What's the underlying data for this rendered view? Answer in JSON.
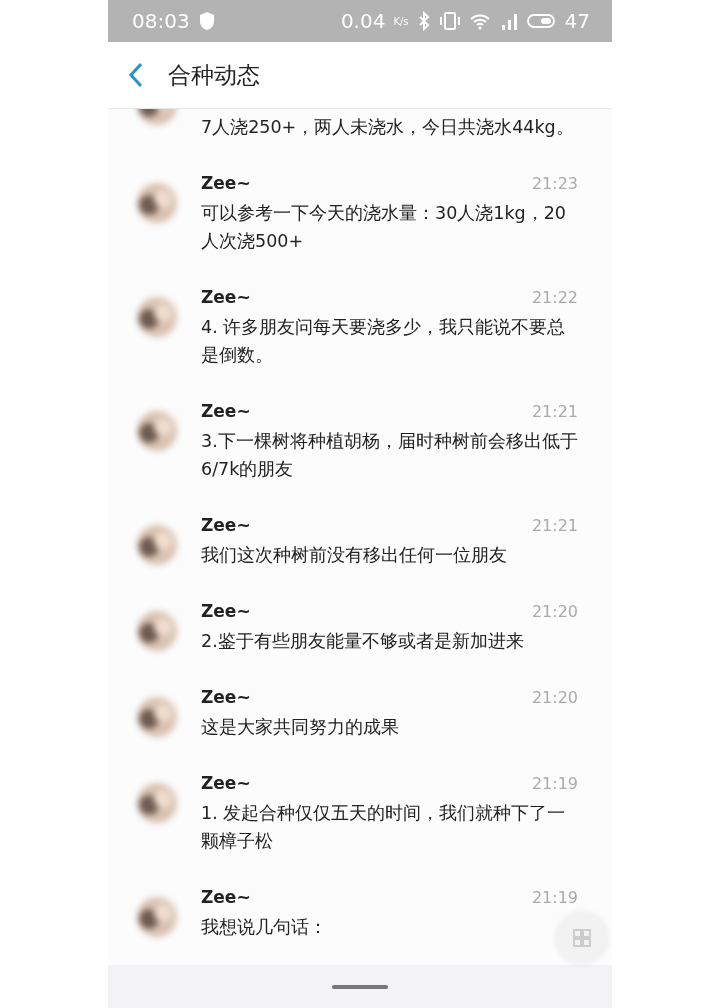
{
  "status_bar": {
    "time": "08:03",
    "net_speed": "0.04",
    "speed_unit": "K/s",
    "battery": "47"
  },
  "header": {
    "title": "合种动态"
  },
  "messages": [
    {
      "text": "7人浇250+，两人未浇水，今日共浇水44kg。"
    },
    {
      "name": "Zee~",
      "time": "21:23",
      "text": "可以参考一下今天的浇水量：30人浇1kg，20人次浇500+"
    },
    {
      "name": "Zee~",
      "time": "21:22",
      "text": "4. 许多朋友问每天要浇多少，我只能说不要总是倒数。"
    },
    {
      "name": "Zee~",
      "time": "21:21",
      "text": "3.下一棵树将种植胡杨，届时种树前会移出低于6/7k的朋友"
    },
    {
      "name": "Zee~",
      "time": "21:21",
      "text": "我们这次种树前没有移出任何一位朋友"
    },
    {
      "name": "Zee~",
      "time": "21:20",
      "text": "2.鉴于有些朋友能量不够或者是新加进来"
    },
    {
      "name": "Zee~",
      "time": "21:20",
      "text": "这是大家共同努力的成果"
    },
    {
      "name": "Zee~",
      "time": "21:19",
      "text": "1. 发起合种仅仅五天的时间，我们就种下了一颗樟子松"
    },
    {
      "name": "Zee~",
      "time": "21:19",
      "text": "我想说几句话："
    }
  ]
}
